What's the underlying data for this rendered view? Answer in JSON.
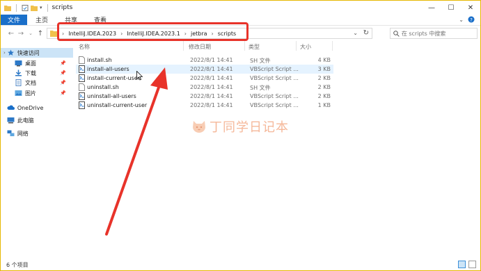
{
  "window": {
    "title": "scripts",
    "controls": {
      "minimize": "—",
      "maximize": "☐",
      "close": "✕"
    }
  },
  "ribbon": {
    "tabs": [
      {
        "label": "文件",
        "active": true
      },
      {
        "label": "主页",
        "active": false
      },
      {
        "label": "共享",
        "active": false
      },
      {
        "label": "查看",
        "active": false
      }
    ]
  },
  "address": {
    "breadcrumbs": [
      "IntelliJ.IDEA.2023",
      "IntelliJ.IDEA.2023.1",
      "jetbra",
      "scripts"
    ],
    "search_placeholder": "在 scripts 中搜索"
  },
  "sidebar": {
    "items": [
      {
        "label": "快速访问",
        "icon": "star-icon",
        "pinned": false
      },
      {
        "label": "桌面",
        "icon": "desktop-icon",
        "pinned": true
      },
      {
        "label": "下载",
        "icon": "download-icon",
        "pinned": true
      },
      {
        "label": "文档",
        "icon": "document-icon",
        "pinned": true
      },
      {
        "label": "图片",
        "icon": "pictures-icon",
        "pinned": true
      },
      {
        "label": "OneDrive",
        "icon": "cloud-icon",
        "pinned": false
      },
      {
        "label": "此电脑",
        "icon": "computer-icon",
        "pinned": false
      },
      {
        "label": "网络",
        "icon": "network-icon",
        "pinned": false
      }
    ]
  },
  "files": {
    "columns": [
      "名称",
      "修改日期",
      "类型",
      "大小"
    ],
    "rows": [
      {
        "name": "install.sh",
        "date": "2022/8/1 14:41",
        "type": "SH 文件",
        "size": "4 KB",
        "icon": "sh-file-icon"
      },
      {
        "name": "install-all-users",
        "date": "2022/8/1 14:41",
        "type": "VBScript Script ...",
        "size": "3 KB",
        "icon": "vbscript-file-icon"
      },
      {
        "name": "install-current-user",
        "date": "2022/8/1 14:41",
        "type": "VBScript Script ...",
        "size": "2 KB",
        "icon": "vbscript-file-icon"
      },
      {
        "name": "uninstall.sh",
        "date": "2022/8/1 14:41",
        "type": "SH 文件",
        "size": "2 KB",
        "icon": "sh-file-icon"
      },
      {
        "name": "uninstall-all-users",
        "date": "2022/8/1 14:41",
        "type": "VBScript Script ...",
        "size": "2 KB",
        "icon": "vbscript-file-icon"
      },
      {
        "name": "uninstall-current-user",
        "date": "2022/8/1 14:41",
        "type": "VBScript Script ...",
        "size": "1 KB",
        "icon": "vbscript-file-icon"
      }
    ]
  },
  "watermark": {
    "text": "丁同学日记本"
  },
  "status": {
    "item_count": "6 个项目"
  },
  "colors": {
    "accent": "#1a6fc9",
    "highlight": "#e8332a",
    "selection": "#cce4f7"
  }
}
